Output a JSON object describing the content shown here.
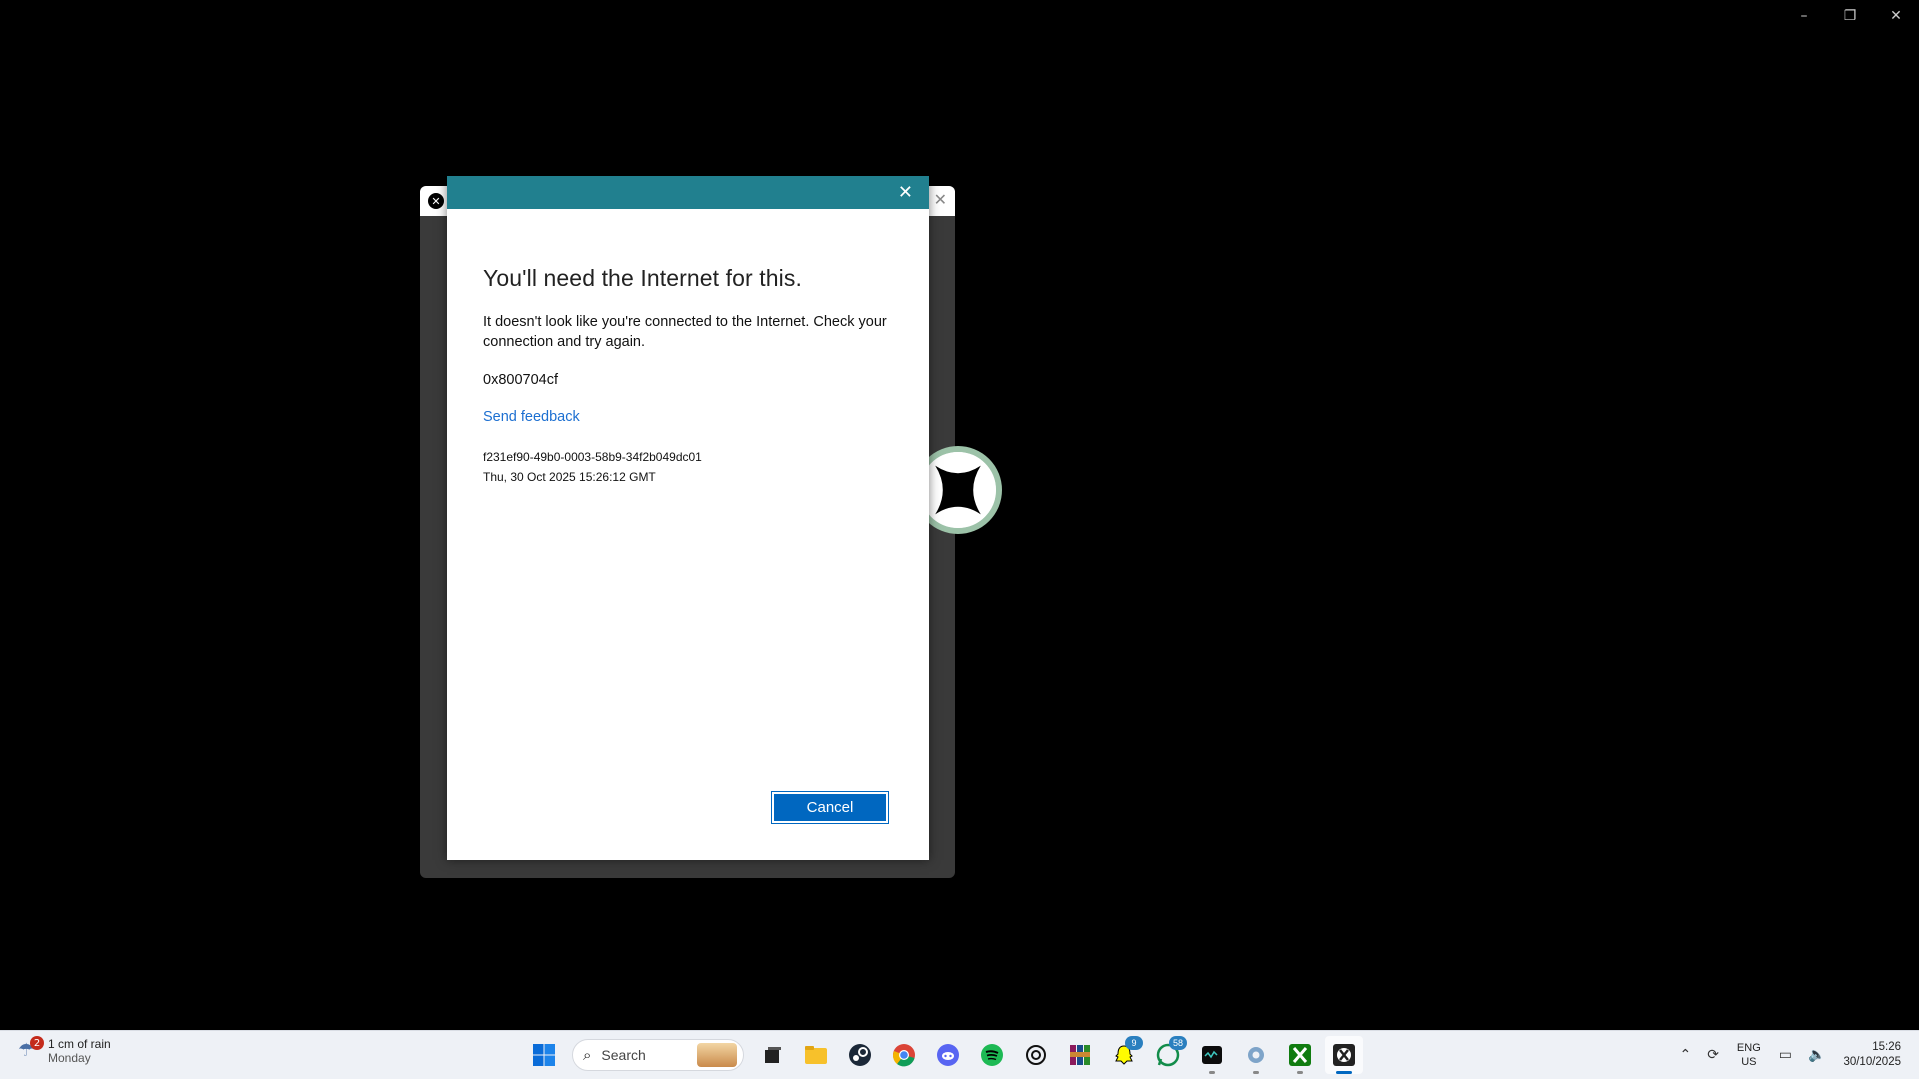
{
  "window_controls": {
    "minimize": "–",
    "restore": "❐",
    "close": "✕"
  },
  "dialog": {
    "title": "You'll need the Internet for this.",
    "message": "It doesn't look like you're connected to the Internet. Check your connection and try again.",
    "error_code": "0x800704cf",
    "feedback_link": "Send feedback",
    "correlation_id": "f231ef90-49b0-0003-58b9-34f2b049dc01",
    "timestamp": "Thu, 30 Oct 2025 15:26:12 GMT",
    "cancel_label": "Cancel",
    "close_glyph": "✕",
    "accent_color": "#21808f"
  },
  "taskbar": {
    "weather": {
      "badge": "2",
      "line1": "1 cm of rain",
      "line2": "Monday"
    },
    "search_placeholder": "Search",
    "apps": [
      {
        "name": "start-icon"
      },
      {
        "name": "task-view-icon"
      },
      {
        "name": "file-explorer-icon"
      },
      {
        "name": "steam-icon"
      },
      {
        "name": "chrome-icon"
      },
      {
        "name": "discord-icon"
      },
      {
        "name": "spotify-icon"
      },
      {
        "name": "chatgpt-icon"
      },
      {
        "name": "winrar-icon"
      },
      {
        "name": "snapchat-icon",
        "badge": "9"
      },
      {
        "name": "whatsapp-icon",
        "badge": "58"
      },
      {
        "name": "terminal-icon"
      },
      {
        "name": "settings-icon"
      },
      {
        "name": "xbox-icon"
      },
      {
        "name": "xbox-app-icon"
      }
    ],
    "tray": {
      "lang1": "ENG",
      "lang2": "US",
      "time": "15:26",
      "date": "30/10/2025"
    }
  }
}
